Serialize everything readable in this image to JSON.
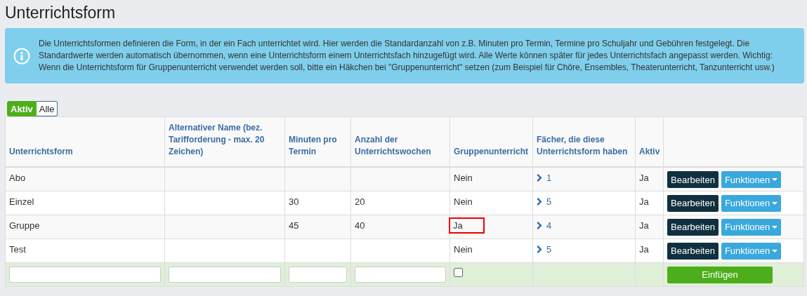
{
  "title": "Unterrichtsform",
  "info": "Die Unterrichtsformen definieren die Form, in der ein Fach unterrichtet wird. Hier werden die Standardanzahl von z.B. Minuten pro Termin, Termine pro Schuljahr und Gebühren festgelegt. Die Standardwerte werden automatisch übernommen, wenn eine Unterrichtsform einem Unterrichtsfach hinzugefügt wird. Alle Werte können später für jedes Unterrichtsfach angepasst werden. Wichtig: Wenn die Unterrichtsform für Gruppenunterricht verwendet werden soll, bitte ein Häkchen bei \"Gruppenunterricht\" setzen (zum Beispiel für Chöre, Ensembles, Theaterunterricht, Tanzunterricht usw.)",
  "filter": [
    {
      "label": "Aktiv",
      "selected": true
    },
    {
      "label": "Alle",
      "selected": false
    }
  ],
  "columns": [
    "Unterrichtsform",
    "Alternativer Name (bez. Tarifforderung - max. 20 Zeichen)",
    "Minuten pro Termin",
    "Anzahl der Unterrichtswochen",
    "Gruppenunterricht",
    "Fächer, die diese Unterrichtsform haben",
    "Aktiv"
  ],
  "rows": [
    {
      "name": "Abo",
      "minutes": "",
      "weeks": "",
      "group": "Nein",
      "highlighted": false,
      "subjects": "1",
      "active": "Ja",
      "edit": "Bearbeiten",
      "functions": "Funktionen"
    },
    {
      "name": "Einzel",
      "minutes": "30",
      "weeks": "20",
      "group": "Nein",
      "highlighted": false,
      "subjects": "5",
      "active": "Ja",
      "edit": "Bearbeiten",
      "functions": "Funktionen"
    },
    {
      "name": "Gruppe",
      "minutes": "45",
      "weeks": "40",
      "group": "Ja",
      "highlighted": true,
      "subjects": "4",
      "active": "Ja",
      "edit": "Bearbeiten",
      "functions": "Funktionen"
    },
    {
      "name": "Test",
      "minutes": "",
      "weeks": "",
      "group": "Nein",
      "highlighted": false,
      "subjects": "5",
      "active": "Ja",
      "edit": "Bearbeiten",
      "functions": "Funktionen"
    }
  ],
  "new_row": {
    "group_checked": false,
    "insert": "Einfügen"
  }
}
